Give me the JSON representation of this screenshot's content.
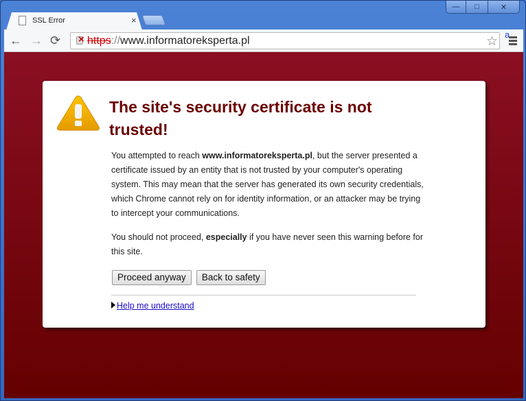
{
  "window": {
    "buttons": {
      "minimize": "—",
      "maximize": "□",
      "close": "✕"
    }
  },
  "tab": {
    "title": "SSL Error",
    "close": "×"
  },
  "toolbar": {
    "back": "←",
    "forward": "→",
    "reload": "⟳",
    "url_scheme": "https",
    "url_sep": "://",
    "url_host": "www.informatoreksperta.pl",
    "star": "☆",
    "extension_label": "a"
  },
  "error": {
    "title": "The site's security certificate is not trusted!",
    "p1_before": "You attempted to reach ",
    "p1_host": "www.informatoreksperta.pl",
    "p1_after": ", but the server presented a certificate issued by an entity that is not trusted by your computer's operating system. This may mean that the server has generated its own security credentials, which Chrome cannot rely on for identity information, or an attacker may be trying to intercept your communications.",
    "p2_before": "You should not proceed, ",
    "p2_bold": "especially",
    "p2_after": " if you have never seen this warning before for this site.",
    "proceed_label": "Proceed anyway",
    "back_label": "Back to safety",
    "help_label": "Help me understand"
  },
  "colors": {
    "background": "#7a0a16",
    "title": "#6a0000",
    "link": "#1a0dcc"
  }
}
